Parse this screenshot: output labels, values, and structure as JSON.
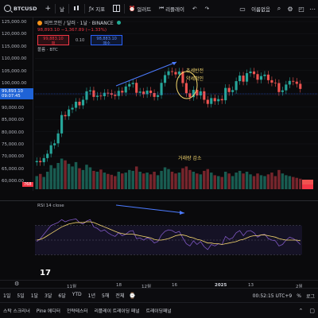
{
  "toolbar": {
    "symbol": "BTCUSD",
    "add_symbol": "+",
    "timeframe": "날",
    "indicators": "지표",
    "alert": "얼러트",
    "replay": "리플레이",
    "account": "이름없음",
    "icons": [
      "candles-icon",
      "bars-icon",
      "indicators-icon",
      "layout-icon",
      "alert-icon",
      "replay-icon",
      "undo-icon",
      "redo-icon",
      "layout-grid-icon",
      "search-icon",
      "camera-icon",
      "more-icon"
    ]
  },
  "legend": {
    "title": "비트코인 / 달러 · 1날 · BINANCE",
    "ohlc": "98,893.10 −1,367.89 (−1.33%)",
    "sell_price": "99,883.10",
    "sell_label": "매",
    "buy_price": "98,883.10",
    "buy_label": "매수",
    "spread": "0.10",
    "volume_label": "볼륨 · BTC"
  },
  "price_scale": {
    "ticks": [
      "125,000.00",
      "120,000.00",
      "115,000.00",
      "110,000.00",
      "105,000.00",
      "100,000.00",
      "95,000.00",
      "90,000.00",
      "85,000.00",
      "80,000.00",
      "75,000.00",
      "70,000.00",
      "65,000.00",
      "60,000.00"
    ],
    "current_price": "99,893.10",
    "countdown": "09:07:45",
    "volume_tag": "768",
    "right_tag_a": "255",
    "right_tag_b": "50"
  },
  "annotations": {
    "trend_reversal": "추세반전",
    "volume_drop": "거래량 감소",
    "highlight": "약세확인"
  },
  "rsi": {
    "label": "RSI 14 close",
    "levels": [
      "70",
      "50",
      "30"
    ]
  },
  "date_axis": {
    "ticks": [
      "11월",
      "18",
      "12월",
      "16",
      "2025",
      "13",
      "2월"
    ]
  },
  "range_bar": {
    "ranges": [
      "1일",
      "5일",
      "1달",
      "3달",
      "6달",
      "YTD",
      "1년",
      "5해",
      "전체"
    ],
    "time": "00:52:15 UTC+9",
    "percent": "%",
    "log": "로그"
  },
  "bottom_bar": {
    "items": [
      "스탁 스크리너",
      "Pine 에디터",
      "전략테스터",
      "리플레이 트레이딩 패널",
      "트레이딩패널"
    ]
  },
  "chart_data": {
    "type": "candlestick",
    "title": "비트코인 / 달러 · 1날 · BINANCE",
    "ylim": [
      58000,
      127000
    ],
    "close_series": [
      69000,
      68500,
      70200,
      72000,
      75500,
      76300,
      80400,
      88000,
      87500,
      90300,
      91000,
      93500,
      92000,
      94300,
      97800,
      98200,
      95500,
      96000,
      95800,
      97200,
      97000,
      96400,
      95900,
      98000,
      97300,
      99800,
      100800,
      101300,
      97200,
      97700,
      96600,
      98100,
      97100,
      95500,
      96200,
      101300,
      104500,
      106100,
      105800,
      104800,
      106000,
      101200,
      97000,
      95400,
      98400,
      96100,
      97800,
      94300,
      92600,
      95000,
      93700,
      94600,
      94100,
      99200,
      97500,
      98300,
      102000,
      104300,
      101800,
      105300,
      106000,
      104900,
      102600,
      104100,
      104700,
      102400,
      101400,
      101200,
      97500,
      98200,
      100600,
      102100,
      101800,
      100900,
      98800
    ],
    "rsi_series": [
      48,
      52,
      58,
      64,
      70,
      72,
      74,
      78,
      75,
      77,
      78,
      79,
      74,
      72,
      76,
      78,
      68,
      66,
      62,
      64,
      60,
      57,
      55,
      60,
      56,
      58,
      62,
      63,
      52,
      53,
      50,
      53,
      51,
      46,
      48,
      57,
      62,
      64,
      63,
      60,
      62,
      53,
      45,
      42,
      49,
      44,
      48,
      41,
      37,
      44,
      42,
      45,
      44,
      55,
      51,
      53,
      60,
      63,
      56,
      62,
      63,
      60,
      54,
      57,
      58,
      52,
      50,
      49,
      42,
      44,
      50,
      54,
      52,
      49,
      44
    ],
    "rsi_ma_series": [
      50,
      51,
      53,
      56,
      59,
      62,
      65,
      68,
      70,
      72,
      73,
      74,
      74,
      74,
      75,
      75,
      74,
      72,
      70,
      68,
      66,
      64,
      62,
      60,
      59,
      58,
      58,
      58,
      57,
      56,
      55,
      54,
      53,
      51,
      50,
      50,
      51,
      52,
      54,
      56,
      57,
      57,
      56,
      54,
      53,
      51,
      50,
      48,
      46,
      46,
      45,
      45,
      44,
      45,
      46,
      47,
      48,
      50,
      51,
      53,
      55,
      56,
      56,
      57,
      57,
      56,
      55,
      54,
      52,
      51,
      50,
      50,
      50,
      50,
      49
    ],
    "volume_series": [
      30,
      35,
      28,
      40,
      55,
      48,
      60,
      70,
      66,
      58,
      52,
      62,
      48,
      44,
      56,
      50,
      42,
      40,
      45,
      38,
      35,
      33,
      30,
      40,
      36,
      38,
      44,
      42,
      52,
      40,
      36,
      38,
      34,
      40,
      32,
      42,
      50,
      46,
      40,
      36,
      38,
      48,
      52,
      44,
      40,
      36,
      34,
      42,
      46,
      38,
      32,
      30,
      28,
      40,
      36,
      30,
      38,
      42,
      36,
      40,
      34,
      30,
      36,
      32,
      30,
      34,
      38,
      30,
      44,
      36,
      32,
      30,
      28,
      26,
      24
    ]
  }
}
